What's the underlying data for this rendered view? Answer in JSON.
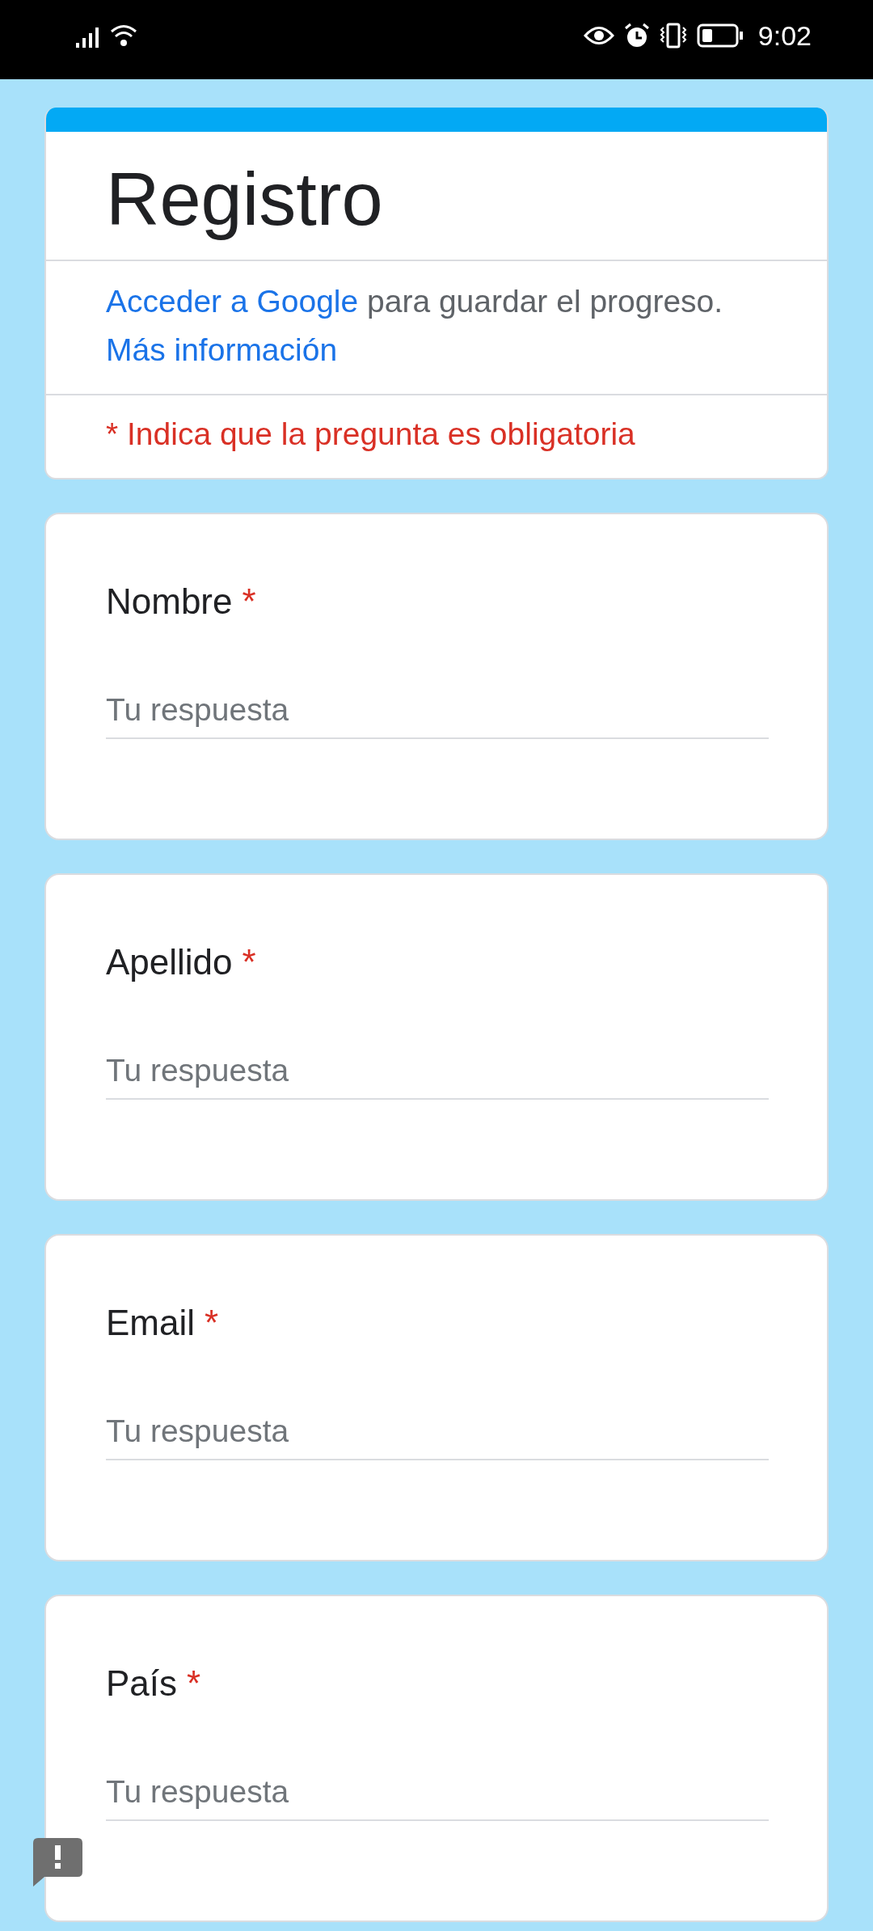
{
  "status_bar": {
    "time": "9:02"
  },
  "form_header": {
    "title": "Registro",
    "sign_in": {
      "link": "Acceder a Google",
      "text": " para guardar el progreso. ",
      "more_link": "Más información"
    },
    "required_note": "* Indica que la pregunta es obligatoria"
  },
  "questions": [
    {
      "label": "Nombre",
      "mark": "*",
      "placeholder": "Tu respuesta"
    },
    {
      "label": "Apellido",
      "mark": "*",
      "placeholder": "Tu respuesta"
    },
    {
      "label": "Email",
      "mark": "*",
      "placeholder": "Tu respuesta"
    },
    {
      "label": "País",
      "mark": "*",
      "placeholder": "Tu respuesta"
    }
  ]
}
